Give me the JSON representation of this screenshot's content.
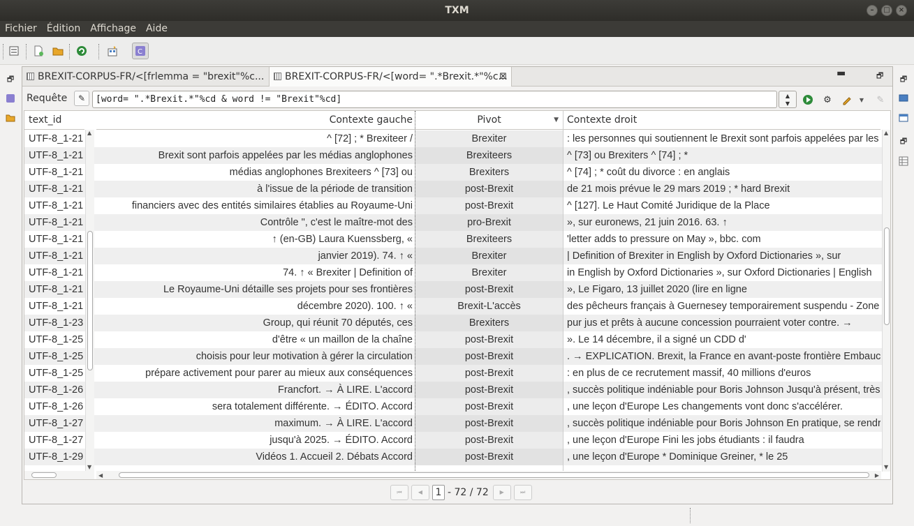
{
  "window": {
    "title": "TXM"
  },
  "menu": [
    "Fichier",
    "Édition",
    "Affichage",
    "Aide"
  ],
  "tabs": [
    {
      "label": "BREXIT-CORPUS-FR/<[frlemma = \"brexit\"%c..."
    },
    {
      "label": "BREXIT-CORPUS-FR/<[word= \".*Brexit.*\"%c...",
      "active": true
    }
  ],
  "query": {
    "label": "Requête",
    "value": "[word= \".*Brexit.*\"%cd & word != \"Brexit\"%cd]"
  },
  "table": {
    "headers": {
      "text_id": "text_id",
      "left": "Contexte gauche",
      "pivot": "Pivot",
      "right": "Contexte droit"
    },
    "rows": [
      {
        "id": "UTF-8_1-21",
        "left": "^ [72] ; * Brexiteer /",
        "pivot": "Brexiter",
        "right": ": les personnes qui soutiennent le Brexit sont parfois appelées par les"
      },
      {
        "id": "UTF-8_1-21",
        "left": "Brexit sont parfois appelées par les médias anglophones",
        "pivot": "Brexiteers",
        "right": "^ [73] ou Brexiters ^ [74] ; *"
      },
      {
        "id": "UTF-8_1-21",
        "left": "médias anglophones Brexiteers ^ [73] ou",
        "pivot": "Brexiters",
        "right": "^ [74] ; * coût du divorce : en anglais"
      },
      {
        "id": "UTF-8_1-21",
        "left": "à l'issue de la période de transition",
        "pivot": "post-Brexit",
        "right": "de 21 mois prévue le 29 mars 2019 ; * hard Brexit"
      },
      {
        "id": "UTF-8_1-21",
        "left": "financiers avec des entités similaires établies au Royaume-Uni",
        "pivot": "post-Brexit",
        "right": "^ [127]. Le Haut Comité Juridique de la Place"
      },
      {
        "id": "UTF-8_1-21",
        "left": "Contrôle \", c'est le maître-mot des",
        "pivot": "pro-Brexit",
        "right": "», sur euronews, 21 juin 2016. 63. ↑"
      },
      {
        "id": "UTF-8_1-21",
        "left": "↑ (en-GB) Laura Kuenssberg, «",
        "pivot": "Brexiteers",
        "right": "'letter adds to pressure on May », bbc. com"
      },
      {
        "id": "UTF-8_1-21",
        "left": "janvier 2019). 74. ↑ «",
        "pivot": "Brexiter",
        "right": "| Definition of Brexiter in English by Oxford Dictionaries », sur"
      },
      {
        "id": "UTF-8_1-21",
        "left": "74. ↑ « Brexiter | Definition of",
        "pivot": "Brexiter",
        "right": "in English by Oxford Dictionaries », sur Oxford Dictionaries | English"
      },
      {
        "id": "UTF-8_1-21",
        "left": "Le Royaume-Uni détaille ses projets pour ses frontières",
        "pivot": "post-Brexit",
        "right": "», Le Figaro, 13 juillet 2020 (lire en ligne"
      },
      {
        "id": "UTF-8_1-21",
        "left": "décembre 2020). 100. ↑ «",
        "pivot": "Brexit-L'accès",
        "right": "des pêcheurs français à Guernesey temporairement suspendu - Zone b"
      },
      {
        "id": "UTF-8_1-23",
        "left": "Group, qui réunit 70 députés, ces",
        "pivot": "Brexiters",
        "right": "pur jus et prêts à aucune concession pourraient voter contre. →"
      },
      {
        "id": "UTF-8_1-25",
        "left": "d'être « un maillon de la chaîne",
        "pivot": "post-Brexit",
        "right": "». Le 14 décembre, il a signé un CDD d'"
      },
      {
        "id": "UTF-8_1-25",
        "left": "choisis pour leur motivation à gérer la circulation",
        "pivot": "post-Brexit",
        "right": ". → EXPLICATION. Brexit, la France en avant-poste frontière Embauc"
      },
      {
        "id": "UTF-8_1-25",
        "left": "prépare activement pour parer au mieux aux conséquences",
        "pivot": "post-Brexit",
        "right": ": en plus de ce recrutement massif, 40 millions d'euros"
      },
      {
        "id": "UTF-8_1-26",
        "left": "Francfort. → À LIRE. L'accord",
        "pivot": "post-Brexit",
        "right": ", succès politique indéniable pour Boris Johnson Jusqu'à présent, très"
      },
      {
        "id": "UTF-8_1-26",
        "left": "sera totalement différente. → ÉDITO. Accord",
        "pivot": "post-Brexit",
        "right": ", une leçon d'Europe Les changements vont donc s'accélérer."
      },
      {
        "id": "UTF-8_1-27",
        "left": "maximum. → À LIRE. L'accord",
        "pivot": "post-Brexit",
        "right": ", succès politique indéniable pour Boris Johnson En pratique, se rendre"
      },
      {
        "id": "UTF-8_1-27",
        "left": "jusqu'à 2025. → ÉDITO. Accord",
        "pivot": "post-Brexit",
        "right": ", une leçon d'Europe Fini les jobs étudiants : il faudra"
      },
      {
        "id": "UTF-8_1-29",
        "left": "Vidéos 1. Accueil 2. Débats Accord",
        "pivot": "post-Brexit",
        "right": ", une leçon d'Europe * Dominique Greiner, * le 25"
      }
    ]
  },
  "pager": {
    "current": "1",
    "total": "- 72 / 72"
  }
}
